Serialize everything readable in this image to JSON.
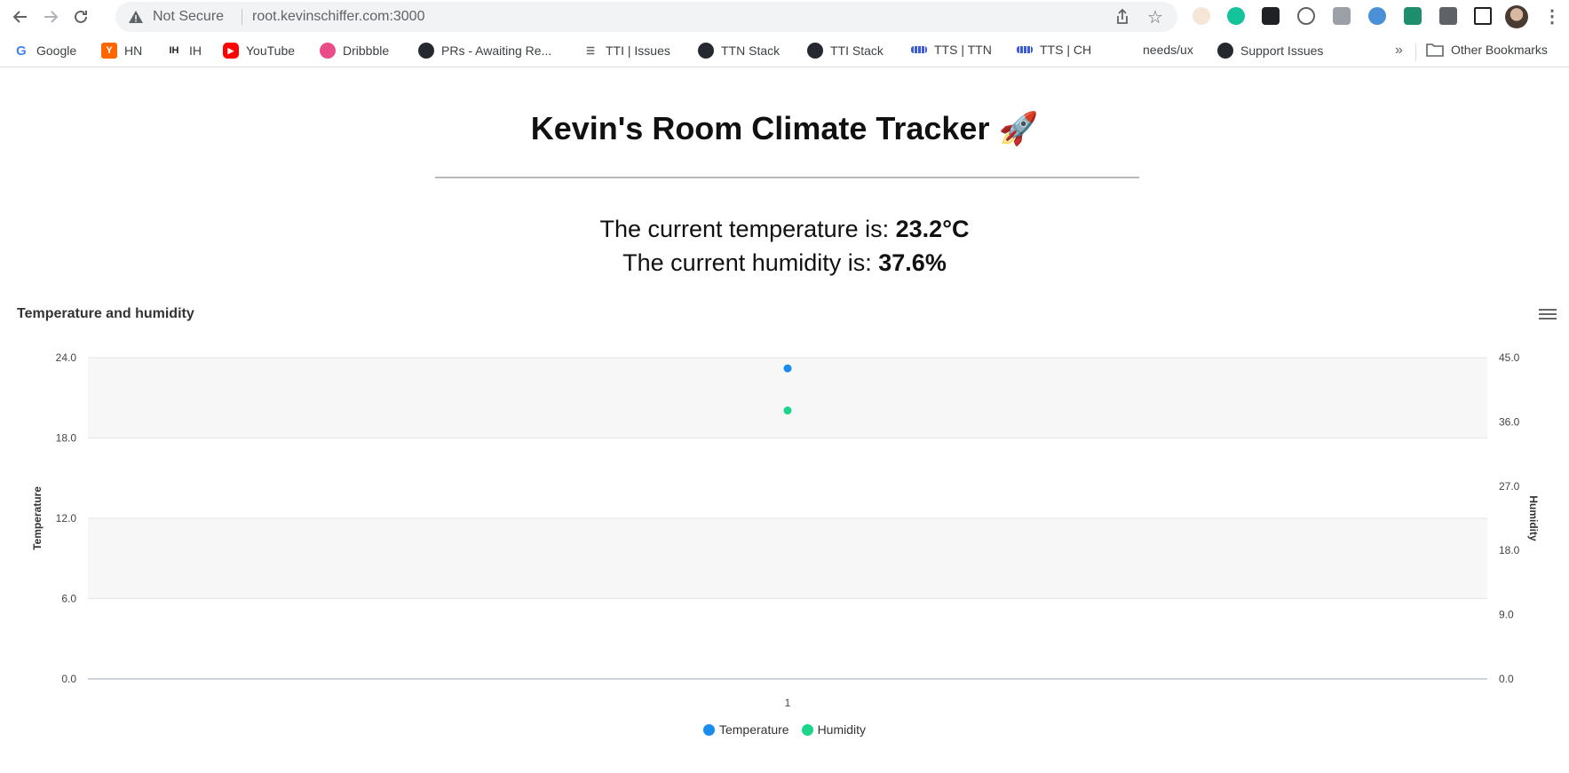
{
  "browser": {
    "security_label": "Not Secure",
    "url": "root.kevinschiffer.com:3000",
    "bookmarks": [
      {
        "label": "Google",
        "icon": "google-icon"
      },
      {
        "label": "HN",
        "icon": "hackernews-icon"
      },
      {
        "label": "IH",
        "icon": "indiehackers-icon"
      },
      {
        "label": "YouTube",
        "icon": "youtube-icon"
      },
      {
        "label": "Dribbble",
        "icon": "dribbble-icon"
      },
      {
        "label": "PRs - Awaiting Re...",
        "icon": "github-icon"
      },
      {
        "label": "TTI | Issues",
        "icon": "list-icon"
      },
      {
        "label": "TTN Stack",
        "icon": "github-icon"
      },
      {
        "label": "TTI Stack",
        "icon": "github-icon"
      },
      {
        "label": "TTS | TTN",
        "icon": "stripes-icon"
      },
      {
        "label": "TTS | CH",
        "icon": "stripes-icon"
      },
      {
        "label": "needs/ux",
        "icon": ""
      },
      {
        "label": "Support Issues",
        "icon": "github-icon"
      }
    ],
    "more_label": "»",
    "other_bookmarks": "Other Bookmarks"
  },
  "page": {
    "title": "Kevin's Room Climate Tracker 🚀",
    "temp_prefix": "The current temperature is: ",
    "temp_value": "23.2°C",
    "hum_prefix": "The current humidity is: ",
    "hum_value": "37.6%"
  },
  "colors": {
    "temperature": "#1a8cf0",
    "humidity": "#19d68a",
    "band": "#f7f7f7",
    "grid": "#e6e6e6"
  },
  "chart_data": {
    "type": "scatter",
    "title": "Temperature and humidity",
    "categories": [
      "1"
    ],
    "y_left": {
      "label": "Temperature",
      "ticks": [
        "0.0",
        "6.0",
        "12.0",
        "18.0",
        "24.0"
      ],
      "range": [
        0,
        24
      ]
    },
    "y_right": {
      "label": "Humidity",
      "ticks": [
        "0.0",
        "9.0",
        "18.0",
        "27.0",
        "36.0",
        "45.0"
      ],
      "range": [
        0,
        45
      ]
    },
    "series": [
      {
        "name": "Temperature",
        "axis": "left",
        "values": [
          23.2
        ]
      },
      {
        "name": "Humidity",
        "axis": "right",
        "values": [
          37.6
        ]
      }
    ],
    "legend_position": "bottom"
  }
}
